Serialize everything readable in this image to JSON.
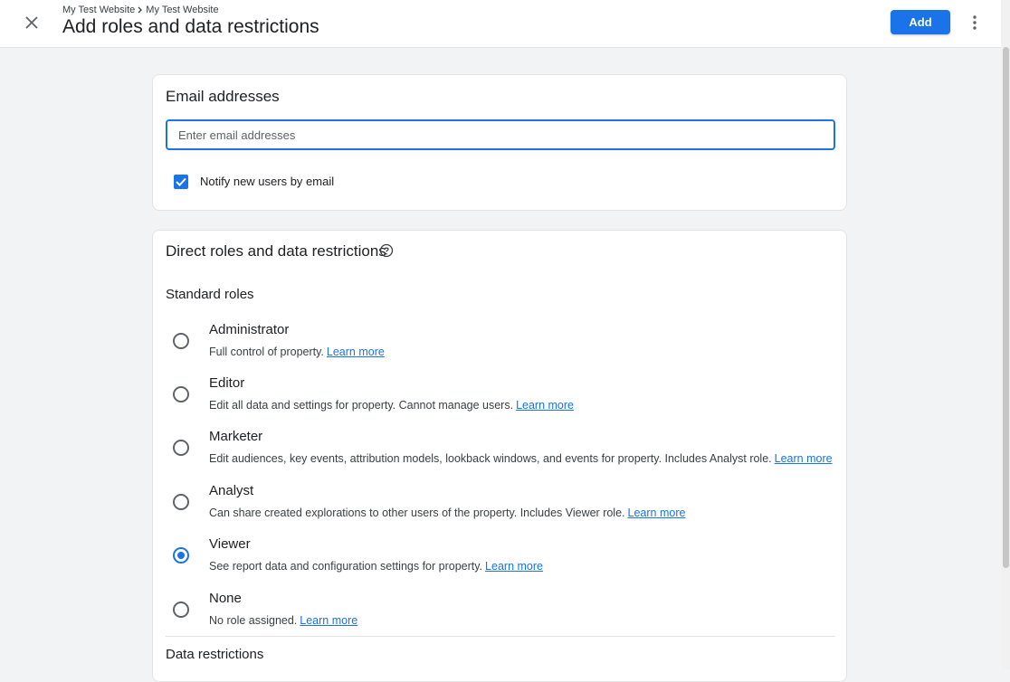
{
  "header": {
    "breadcrumb": [
      "My Test Website",
      "My Test Website"
    ],
    "title": "Add roles and data restrictions",
    "add_label": "Add"
  },
  "email_section": {
    "title": "Email addresses",
    "input_placeholder": "Enter email addresses",
    "input_value": "",
    "notify_label": "Notify new users by email",
    "notify_checked": true
  },
  "roles_section": {
    "title": "Direct roles and data restrictions",
    "standard_roles_label": "Standard roles",
    "learn_more_label": "Learn more",
    "roles": [
      {
        "name": "Administrator",
        "desc": "Full control of property."
      },
      {
        "name": "Editor",
        "desc": "Edit all data and settings for property. Cannot manage users."
      },
      {
        "name": "Marketer",
        "desc": "Edit audiences, key events, attribution models, lookback windows, and events for property. Includes Analyst role."
      },
      {
        "name": "Analyst",
        "desc": "Can share created explorations to other users of the property. Includes Viewer role."
      },
      {
        "name": "Viewer",
        "desc": "See report data and configuration settings for property."
      },
      {
        "name": "None",
        "desc": "No role assigned."
      }
    ],
    "selected_role": "Viewer",
    "data_restrictions_label": "Data restrictions"
  },
  "colors": {
    "accent": "#1a73e8",
    "background": "#f1f3f4"
  }
}
